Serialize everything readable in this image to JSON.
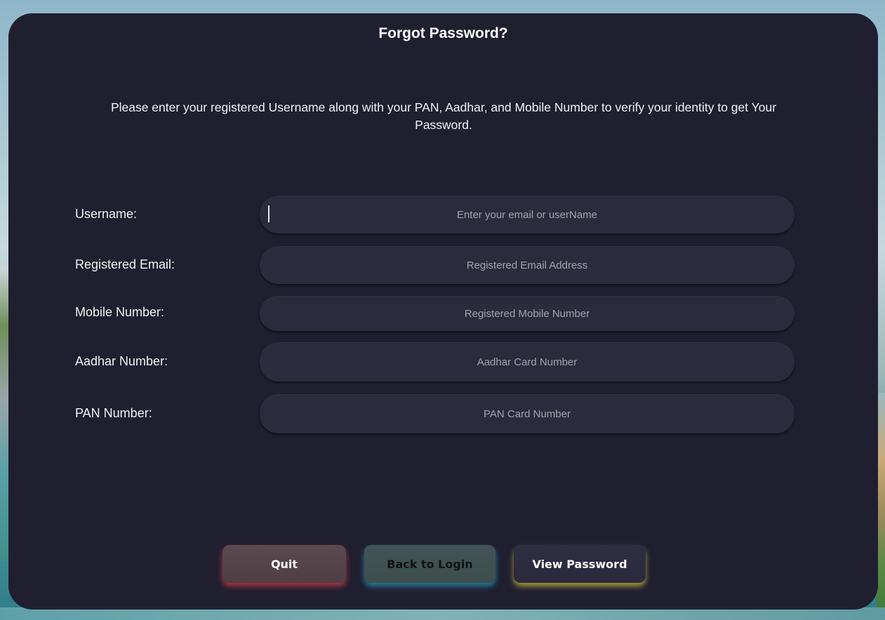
{
  "page": {
    "title": "Forgot Password?",
    "intro": "Please enter your registered Username along with your PAN, Aadhar, and Mobile Number to verify your identity to get Your Password."
  },
  "form": {
    "username": {
      "label": "Username:",
      "placeholder": "Enter your email or userName",
      "value": ""
    },
    "email": {
      "label": "Registered Email:",
      "placeholder": "Registered Email Address",
      "value": ""
    },
    "mobile": {
      "label": "Mobile Number:",
      "placeholder": "Registered Mobile Number",
      "value": ""
    },
    "aadhar": {
      "label": "Aadhar Number:",
      "placeholder": "Aadhar Card Number",
      "value": ""
    },
    "pan": {
      "label": "PAN Number:",
      "placeholder": "PAN Card Number",
      "value": ""
    }
  },
  "buttons": {
    "quit": "Quit",
    "back": "Back to Login",
    "view": "View Password"
  },
  "colors": {
    "panel": "#201f30",
    "field": "#2c2b3d",
    "quit_glow": "#d23c46",
    "back_glow": "#2896be",
    "view_glow": "#beb43c"
  }
}
